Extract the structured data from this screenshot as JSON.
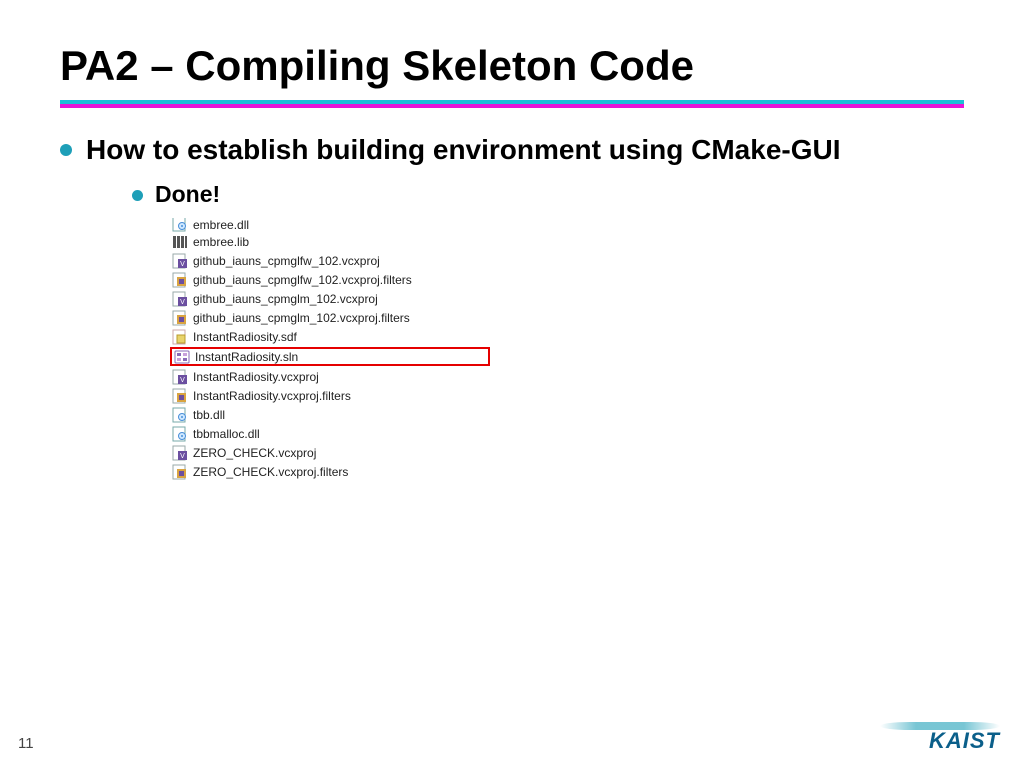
{
  "title": "PA2 – Compiling Skeleton Code",
  "bullet1": "How to establish building environment using CMake-GUI",
  "bullet2": "Done!",
  "files": [
    {
      "name": "embree.dll",
      "icon": "dll",
      "hl": false,
      "cut": true
    },
    {
      "name": "embree.lib",
      "icon": "lib",
      "hl": false
    },
    {
      "name": "github_iauns_cpmglfw_102.vcxproj",
      "icon": "vcxproj",
      "hl": false
    },
    {
      "name": "github_iauns_cpmglfw_102.vcxproj.filters",
      "icon": "filters",
      "hl": false
    },
    {
      "name": "github_iauns_cpmglm_102.vcxproj",
      "icon": "vcxproj",
      "hl": false
    },
    {
      "name": "github_iauns_cpmglm_102.vcxproj.filters",
      "icon": "filters",
      "hl": false
    },
    {
      "name": "InstantRadiosity.sdf",
      "icon": "sdf",
      "hl": false
    },
    {
      "name": "InstantRadiosity.sln",
      "icon": "sln",
      "hl": true
    },
    {
      "name": "InstantRadiosity.vcxproj",
      "icon": "vcxproj",
      "hl": false
    },
    {
      "name": "InstantRadiosity.vcxproj.filters",
      "icon": "filters",
      "hl": false
    },
    {
      "name": "tbb.dll",
      "icon": "dll",
      "hl": false
    },
    {
      "name": "tbbmalloc.dll",
      "icon": "dll",
      "hl": false
    },
    {
      "name": "ZERO_CHECK.vcxproj",
      "icon": "vcxproj",
      "hl": false
    },
    {
      "name": "ZERO_CHECK.vcxproj.filters",
      "icon": "filters",
      "hl": false
    }
  ],
  "highlighted_file": "InstantRadiosity.sln",
  "page_number": "11",
  "logo_text": "KAIST"
}
